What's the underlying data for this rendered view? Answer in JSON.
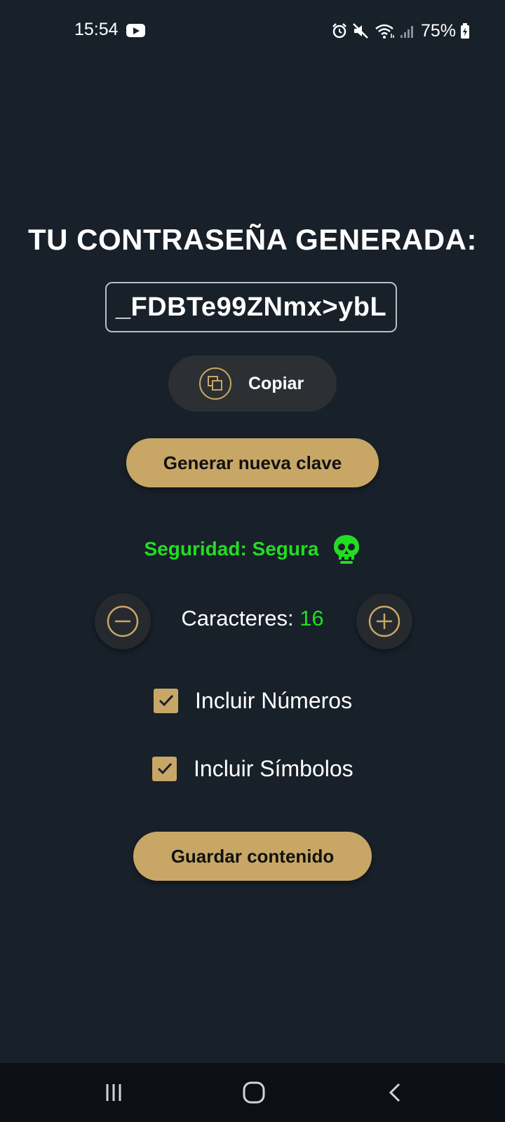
{
  "status_bar": {
    "time": "15:54",
    "battery": "75%",
    "icons": [
      "youtube-icon",
      "alarm-icon",
      "mute-icon",
      "wifi-icon",
      "signal-icon",
      "battery-charging-icon"
    ]
  },
  "main": {
    "title": "TU CONTRASEÑA GENERADA:",
    "password": "_FDBTe99ZNmx>ybL",
    "copy_label": "Copiar",
    "generate_label": "Generar nueva clave",
    "security_text": "Seguridad: Segura",
    "security_icon": "skull-icon",
    "length_label": "Caracteres:",
    "length_value": "16",
    "options": [
      {
        "label": "Incluir Números",
        "checked": true
      },
      {
        "label": "Incluir Símbolos",
        "checked": true
      }
    ],
    "save_label": "Guardar contenido"
  },
  "nav": {
    "items": [
      "recent-apps-icon",
      "home-icon",
      "back-icon"
    ]
  },
  "colors": {
    "background": "#18202a",
    "accent": "#c8a766",
    "secure": "#22dd22",
    "button_dark": "#2c2f33"
  }
}
